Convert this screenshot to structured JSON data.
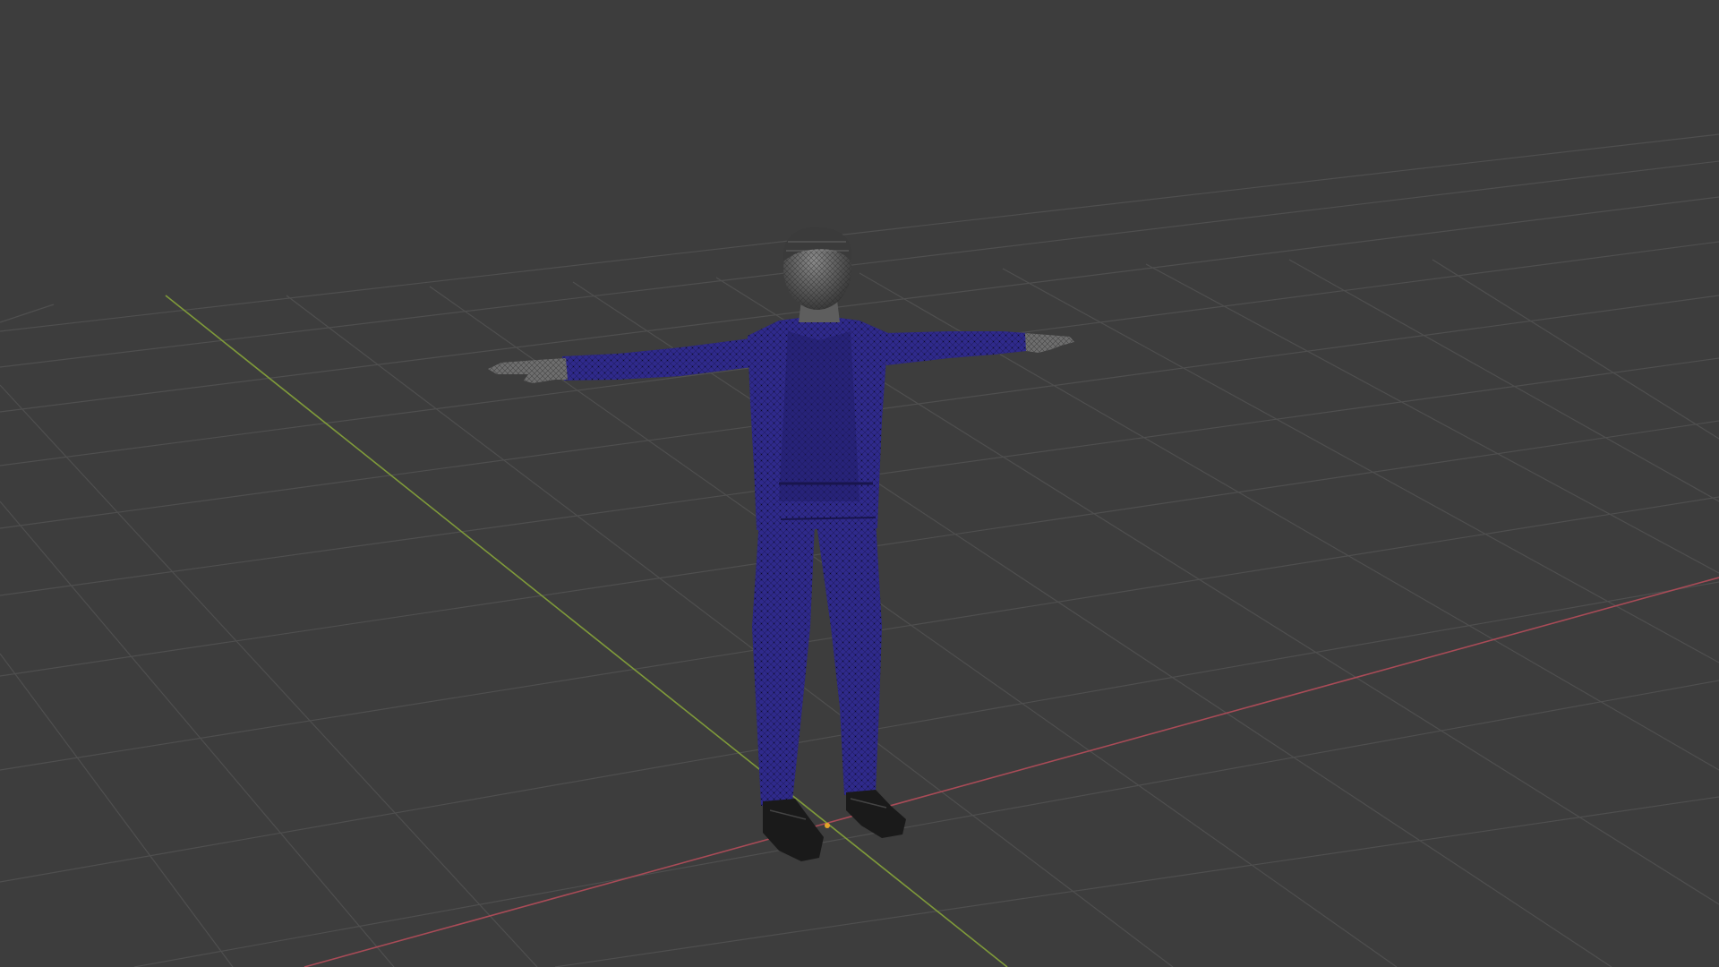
{
  "viewport": {
    "background_color": "#3d3d3d",
    "grid_color": "#4f4f4f",
    "x_axis_color": "#a94b57",
    "y_axis_color": "#7f9a3a",
    "origin_marker_color": "#e3a22a"
  },
  "model": {
    "suit_color": "#2f2a8c",
    "suit_shadow_color": "#201c66",
    "skin_color": "#6e6e6e",
    "shoe_color": "#1a1a1a",
    "wireframe": true
  }
}
